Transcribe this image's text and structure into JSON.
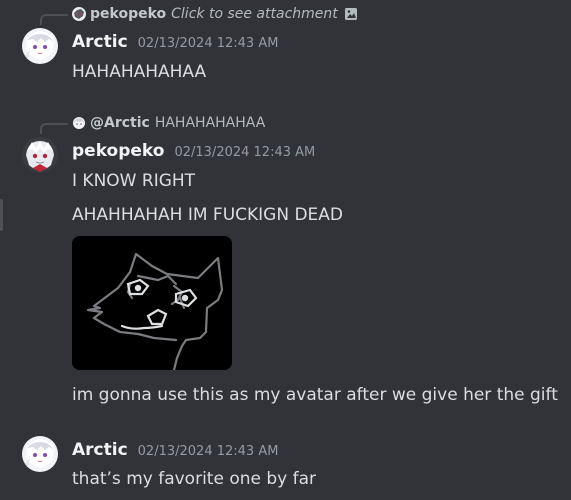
{
  "messages": [
    {
      "reply": {
        "author": "pekopeko",
        "text": "Click to see attachment",
        "icon": "image-icon"
      },
      "author": "Arctic",
      "timestamp": "02/13/2024 12:43 AM",
      "lines": [
        "HAHAHAHAHAA"
      ]
    },
    {
      "reply": {
        "author": "@Arctic",
        "text": "HAHAHAHAHAA"
      },
      "author": "pekopeko",
      "timestamp": "02/13/2024 12:43 AM",
      "lines": [
        "I KNOW RIGHT",
        "AHAHHAHAH IM FUCKIGN DEAD",
        "im gonna use this as my avatar after we give her the gift"
      ],
      "attachment": {
        "kind": "image",
        "description_icon": "cat-drawing-image"
      }
    },
    {
      "author": "Arctic",
      "timestamp": "02/13/2024 12:43 AM",
      "lines": [
        "that’s my favorite one by far"
      ]
    }
  ],
  "colors": {
    "background": "#313338",
    "username": "#f2f3f5",
    "timestamp": "#949ba4",
    "text": "#dbdee1",
    "reply_spine": "#4e5058"
  }
}
